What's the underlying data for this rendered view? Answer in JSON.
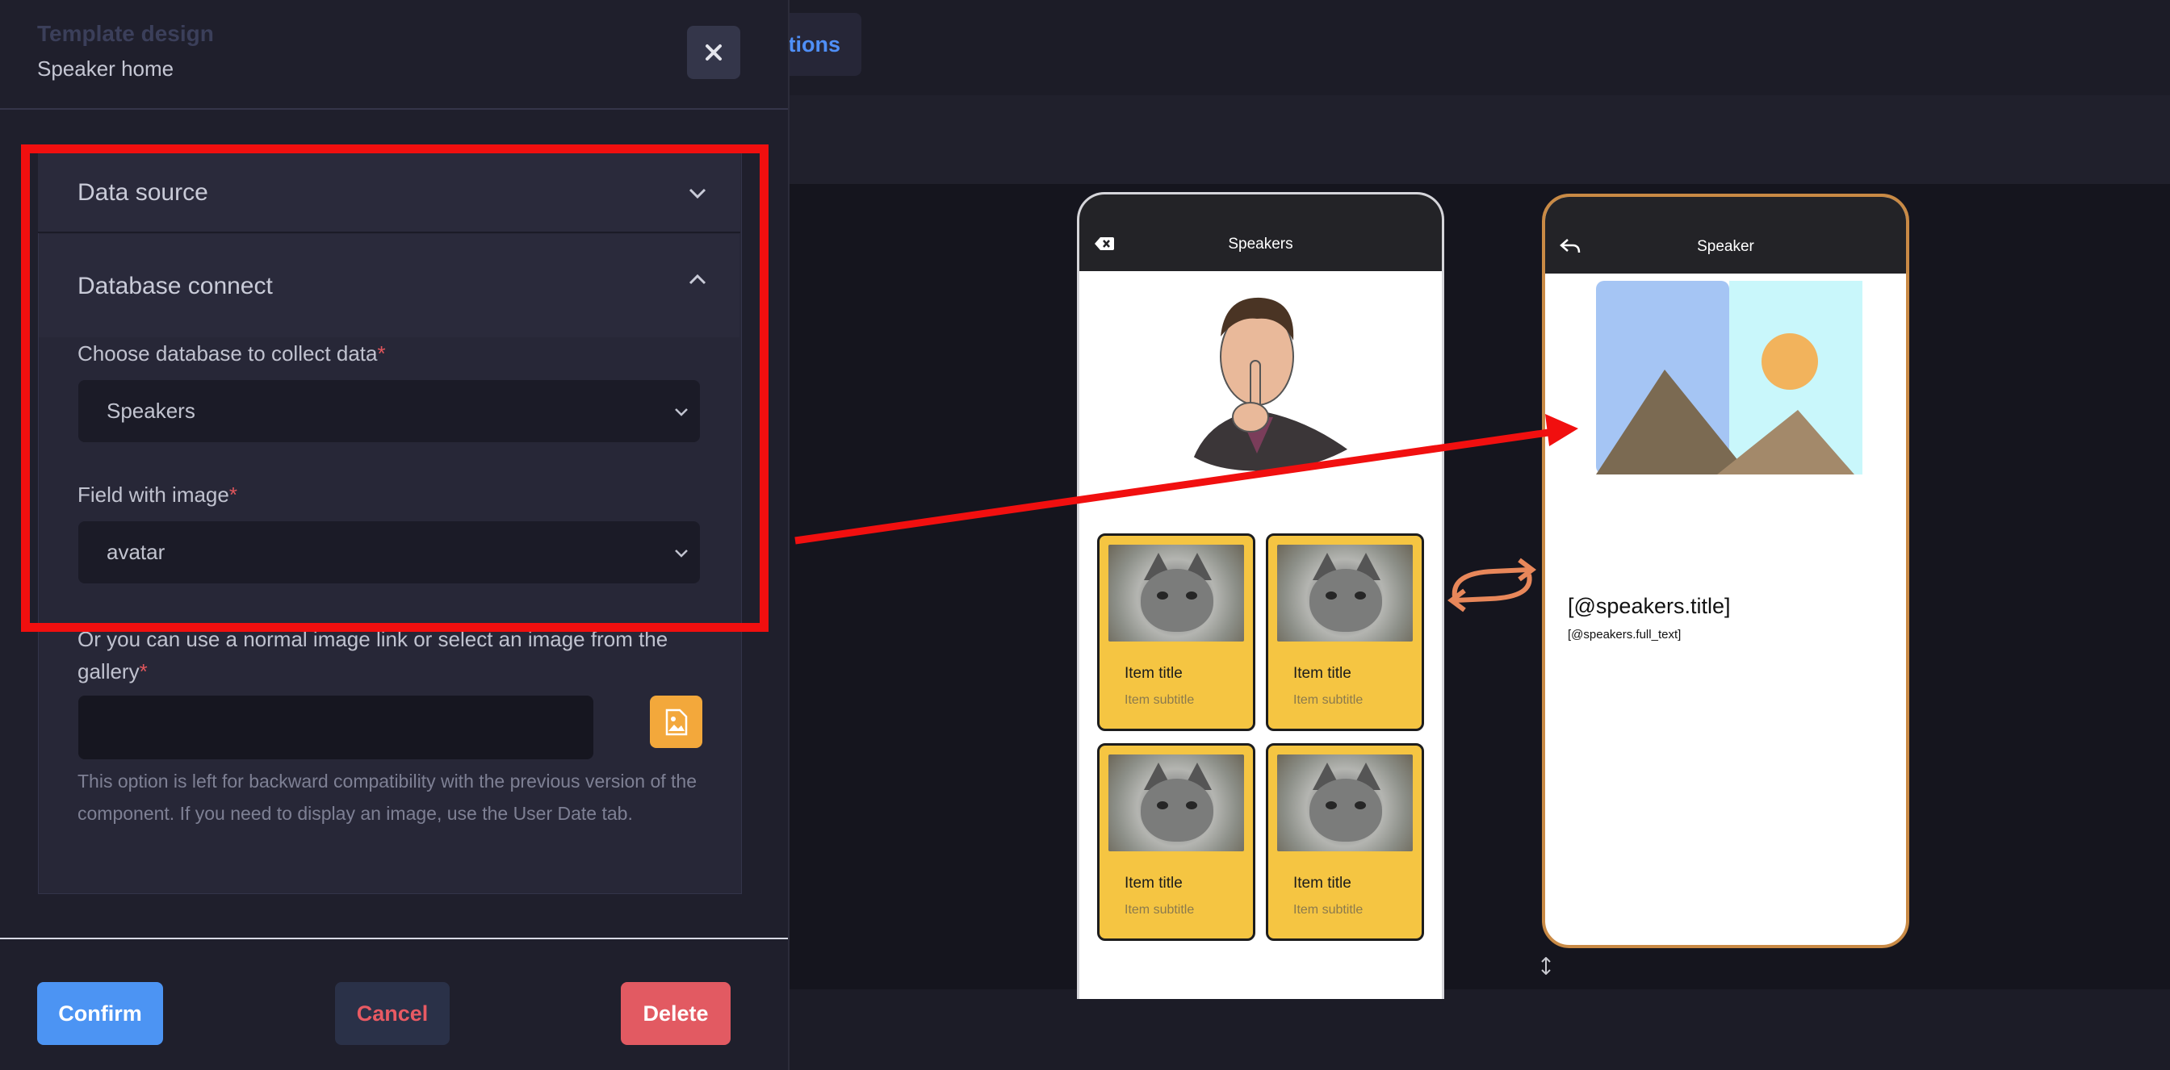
{
  "background": {
    "toolbar_button": "tions",
    "bottom_icon": "resize-vertical-icon"
  },
  "modal": {
    "ghost_title": "Template design",
    "subtitle": "Speaker home",
    "close_icon": "close-icon",
    "sections": {
      "data_source": {
        "label": "Data source",
        "expanded": false
      },
      "database_connect": {
        "label": "Database connect",
        "expanded": true
      }
    },
    "fields": {
      "database": {
        "label": "Choose database to collect data",
        "required": "*",
        "value": "Speakers"
      },
      "image_field": {
        "label": "Field with image",
        "required": "*",
        "value": "avatar"
      },
      "image_link": {
        "label": "Or you can use a normal image link or select an image from the gallery",
        "required": "*",
        "value": "",
        "hint": "This option is left for backward compatibility with the previous version of the component. If you need to display an image, use the User Date tab."
      }
    },
    "buttons": {
      "confirm": "Confirm",
      "cancel": "Cancel",
      "delete": "Delete"
    }
  },
  "phones": {
    "speakers": {
      "title": "Speakers",
      "cards": [
        {
          "title": "Item title",
          "subtitle": "Item subtitle"
        },
        {
          "title": "Item title",
          "subtitle": "Item subtitle"
        },
        {
          "title": "Item title",
          "subtitle": "Item subtitle"
        },
        {
          "title": "Item title",
          "subtitle": "Item subtitle"
        }
      ]
    },
    "speaker": {
      "title": "Speaker",
      "heading": "[@speakers.title]",
      "body": "[@speakers.full_text]"
    }
  },
  "colors": {
    "highlight": "#f10f0f",
    "accent_blue": "#4c94f3",
    "danger": "#e25a62",
    "card_yellow": "#f5c542",
    "link_arrow": "#e8875a"
  }
}
